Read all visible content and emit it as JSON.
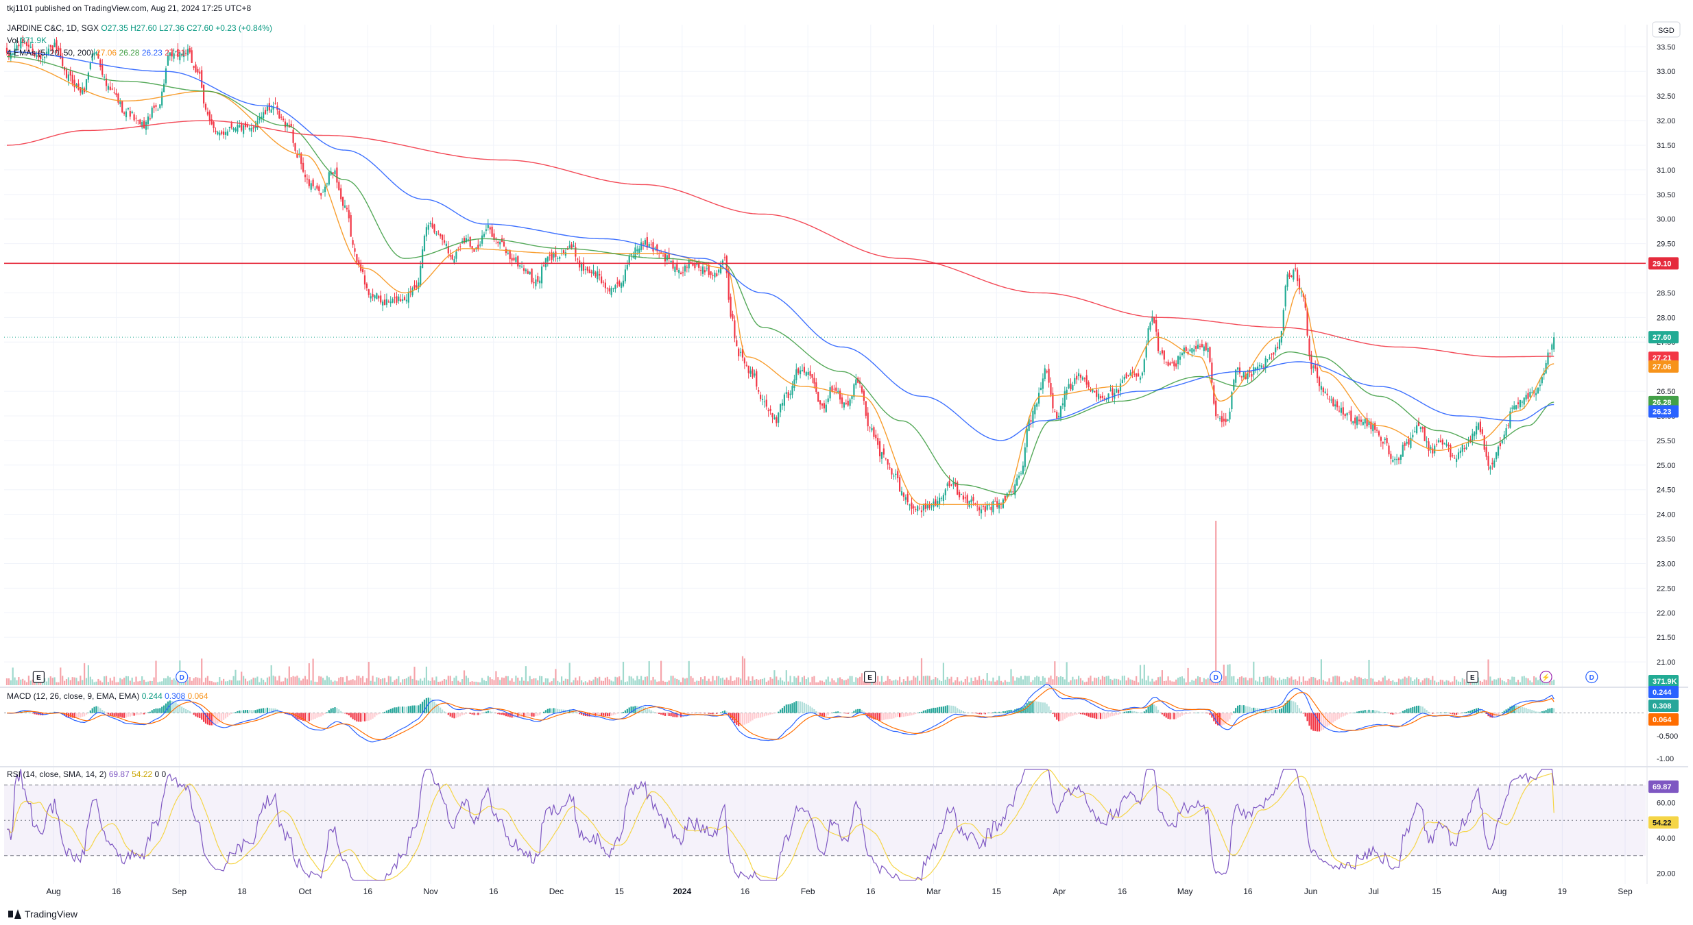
{
  "publisher_line": "tkj1101 published on TradingView.com, Aug 21, 2024 17:25 UTC+8",
  "symbol_legend": {
    "name": "JARDINE C&C, 1D, SGX",
    "open": "O27.35",
    "high": "H27.60",
    "low": "L27.36",
    "close": "C27.60",
    "change": "+0.23 (+0.84%)"
  },
  "volume_legend": {
    "label": "Vol",
    "value": "371.9K"
  },
  "ema_legend": {
    "label": "4 EMAs (5, 20, 50, 200)",
    "values": [
      "27.06",
      "26.28",
      "26.23",
      "27.21"
    ]
  },
  "macd_legend": {
    "label": "MACD (12, 26, close, 9, EMA, EMA)",
    "values": [
      "0.244",
      "0.308",
      "0.064"
    ]
  },
  "rsi_legend": {
    "label": "RSI (14, close, SMA, 14, 2)",
    "values": [
      "69.87",
      "54.22",
      "0",
      "0"
    ]
  },
  "footer": {
    "brand": "TradingView"
  },
  "colors": {
    "up": "#22ab94",
    "down": "#f23645",
    "ema5": "#f7931a",
    "ema20": "#43a047",
    "ema50": "#2962ff",
    "ema200": "#f23645",
    "macd": "#2962ff",
    "signal": "#ff6d00",
    "rsi": "#7e57c2",
    "rsi_ma": "#f5d547"
  },
  "chart_data": {
    "type": "candlestick",
    "currency": "SGD",
    "price_axis_ticks": [
      "33.50",
      "33.00",
      "32.50",
      "32.00",
      "31.50",
      "31.00",
      "30.50",
      "30.00",
      "29.50",
      "28.50",
      "28.00",
      "27.50",
      "26.50",
      "26.00",
      "25.50",
      "25.00",
      "24.50",
      "24.00",
      "23.50",
      "23.00",
      "22.50",
      "22.00",
      "21.50",
      "21.00"
    ],
    "price_range": [
      20.5,
      33.95
    ],
    "time_axis_labels": [
      "Aug",
      "16",
      "Sep",
      "18",
      "Oct",
      "16",
      "Nov",
      "16",
      "Dec",
      "15",
      "2024",
      "16",
      "Feb",
      "16",
      "Mar",
      "15",
      "Apr",
      "16",
      "May",
      "16",
      "Jun",
      "Jul",
      "15",
      "Aug",
      "19",
      "Sep"
    ],
    "horizontal_level": {
      "value": 29.1,
      "label": "29.10"
    },
    "last_price": {
      "value": 27.6,
      "label": "27.60"
    },
    "price_badges": [
      {
        "label": "27.21",
        "value": 27.21,
        "series": "EMA 200"
      },
      {
        "label": "27.06",
        "value": 27.06,
        "series": "EMA 5"
      },
      {
        "label": "26.28",
        "value": 26.28,
        "series": "EMA 20"
      },
      {
        "label": "26.23",
        "value": 26.23,
        "series": "EMA 50"
      }
    ],
    "volume_badge": "371.9K",
    "events": [
      {
        "type": "E",
        "label": "E",
        "date_index": 16
      },
      {
        "type": "D",
        "label": "D",
        "date_index": 88
      },
      {
        "type": "E",
        "label": "E",
        "date_index": 434
      },
      {
        "type": "D",
        "label": "D",
        "date_index": 608
      },
      {
        "type": "E",
        "label": "E",
        "date_index": 737
      },
      {
        "type": "flash",
        "label": "⚡",
        "date_index": 774
      },
      {
        "type": "D",
        "label": "D",
        "date_index": 797
      }
    ],
    "anchor_closes": [
      [
        0,
        33.3
      ],
      [
        8,
        33.6
      ],
      [
        16,
        33.3
      ],
      [
        24,
        33.5
      ],
      [
        30,
        32.9
      ],
      [
        38,
        32.6
      ],
      [
        44,
        33.4
      ],
      [
        52,
        32.6
      ],
      [
        60,
        32.2
      ],
      [
        68,
        31.9
      ],
      [
        76,
        32.3
      ],
      [
        82,
        33.3
      ],
      [
        90,
        33.4
      ],
      [
        96,
        33.0
      ],
      [
        100,
        32.2
      ],
      [
        106,
        31.7
      ],
      [
        114,
        31.9
      ],
      [
        122,
        31.8
      ],
      [
        128,
        32.1
      ],
      [
        134,
        32.3
      ],
      [
        138,
        32.0
      ],
      [
        142,
        31.9
      ],
      [
        146,
        31.3
      ],
      [
        152,
        30.7
      ],
      [
        158,
        30.5
      ],
      [
        164,
        31.0
      ],
      [
        170,
        30.2
      ],
      [
        176,
        29.2
      ],
      [
        182,
        28.5
      ],
      [
        190,
        28.3
      ],
      [
        200,
        28.4
      ],
      [
        206,
        28.7
      ],
      [
        212,
        29.9
      ],
      [
        218,
        29.7
      ],
      [
        224,
        29.2
      ],
      [
        230,
        29.6
      ],
      [
        236,
        29.4
      ],
      [
        242,
        29.8
      ],
      [
        248,
        29.5
      ],
      [
        254,
        29.2
      ],
      [
        260,
        29.0
      ],
      [
        266,
        28.7
      ],
      [
        272,
        29.2
      ],
      [
        278,
        29.3
      ],
      [
        284,
        29.4
      ],
      [
        290,
        29.0
      ],
      [
        296,
        28.9
      ],
      [
        302,
        28.6
      ],
      [
        308,
        28.6
      ],
      [
        314,
        29.3
      ],
      [
        320,
        29.5
      ],
      [
        326,
        29.4
      ],
      [
        332,
        29.2
      ],
      [
        338,
        28.9
      ],
      [
        344,
        29.1
      ],
      [
        350,
        29.0
      ],
      [
        356,
        28.9
      ],
      [
        361,
        29.2
      ],
      [
        364,
        28.0
      ],
      [
        368,
        27.3
      ],
      [
        374,
        26.9
      ],
      [
        380,
        26.4
      ],
      [
        386,
        25.9
      ],
      [
        392,
        26.4
      ],
      [
        398,
        26.9
      ],
      [
        404,
        26.9
      ],
      [
        410,
        26.2
      ],
      [
        416,
        26.6
      ],
      [
        422,
        26.2
      ],
      [
        428,
        26.7
      ],
      [
        434,
        25.8
      ],
      [
        440,
        25.2
      ],
      [
        446,
        24.8
      ],
      [
        452,
        24.3
      ],
      [
        458,
        24.1
      ],
      [
        466,
        24.2
      ],
      [
        474,
        24.6
      ],
      [
        482,
        24.3
      ],
      [
        490,
        24.1
      ],
      [
        498,
        24.2
      ],
      [
        504,
        24.4
      ],
      [
        510,
        24.8
      ],
      [
        514,
        25.9
      ],
      [
        518,
        26.3
      ],
      [
        522,
        26.9
      ],
      [
        528,
        26.0
      ],
      [
        534,
        26.6
      ],
      [
        540,
        26.8
      ],
      [
        546,
        26.5
      ],
      [
        552,
        26.4
      ],
      [
        558,
        26.5
      ],
      [
        564,
        26.8
      ],
      [
        570,
        26.8
      ],
      [
        576,
        28.0
      ],
      [
        580,
        27.3
      ],
      [
        586,
        27.0
      ],
      [
        592,
        27.3
      ],
      [
        598,
        27.4
      ],
      [
        604,
        27.3
      ],
      [
        608,
        26.0
      ],
      [
        612,
        25.8
      ],
      [
        614,
        25.9
      ],
      [
        618,
        26.9
      ],
      [
        624,
        26.8
      ],
      [
        630,
        27.0
      ],
      [
        636,
        27.2
      ],
      [
        640,
        27.5
      ],
      [
        644,
        28.8
      ],
      [
        648,
        28.9
      ],
      [
        652,
        28.4
      ],
      [
        656,
        27.0
      ],
      [
        662,
        26.5
      ],
      [
        668,
        26.2
      ],
      [
        674,
        26.0
      ],
      [
        680,
        25.9
      ],
      [
        686,
        25.8
      ],
      [
        692,
        25.5
      ],
      [
        698,
        25.1
      ],
      [
        704,
        25.4
      ],
      [
        710,
        25.8
      ],
      [
        716,
        25.3
      ],
      [
        722,
        25.5
      ],
      [
        728,
        25.1
      ],
      [
        734,
        25.4
      ],
      [
        740,
        25.8
      ],
      [
        746,
        25.0
      ],
      [
        752,
        25.5
      ],
      [
        758,
        26.2
      ],
      [
        764,
        26.4
      ],
      [
        770,
        26.5
      ],
      [
        776,
        27.35
      ],
      [
        778,
        27.6
      ]
    ],
    "series": [
      {
        "name": "EMA 5",
        "anchors": [
          [
            0,
            33.2
          ],
          [
            60,
            32.4
          ],
          [
            100,
            32.6
          ],
          [
            150,
            31.3
          ],
          [
            180,
            29.0
          ],
          [
            200,
            28.5
          ],
          [
            230,
            29.4
          ],
          [
            280,
            29.3
          ],
          [
            330,
            29.3
          ],
          [
            362,
            29.0
          ],
          [
            372,
            27.2
          ],
          [
            400,
            26.6
          ],
          [
            430,
            26.4
          ],
          [
            460,
            24.2
          ],
          [
            500,
            24.2
          ],
          [
            520,
            26.4
          ],
          [
            560,
            26.6
          ],
          [
            578,
            27.6
          ],
          [
            600,
            27.2
          ],
          [
            610,
            26.3
          ],
          [
            640,
            27.6
          ],
          [
            650,
            28.6
          ],
          [
            662,
            26.9
          ],
          [
            690,
            25.8
          ],
          [
            720,
            25.3
          ],
          [
            740,
            25.5
          ],
          [
            760,
            26.1
          ],
          [
            778,
            27.06
          ]
        ]
      },
      {
        "name": "EMA 20",
        "anchors": [
          [
            0,
            33.3
          ],
          [
            60,
            32.8
          ],
          [
            100,
            32.6
          ],
          [
            140,
            31.9
          ],
          [
            170,
            30.8
          ],
          [
            200,
            29.2
          ],
          [
            240,
            29.6
          ],
          [
            280,
            29.4
          ],
          [
            330,
            29.2
          ],
          [
            360,
            29.1
          ],
          [
            380,
            27.8
          ],
          [
            420,
            26.9
          ],
          [
            450,
            25.9
          ],
          [
            480,
            24.6
          ],
          [
            505,
            24.4
          ],
          [
            525,
            25.9
          ],
          [
            560,
            26.3
          ],
          [
            600,
            26.8
          ],
          [
            620,
            26.6
          ],
          [
            645,
            27.3
          ],
          [
            660,
            27.2
          ],
          [
            690,
            26.4
          ],
          [
            720,
            25.7
          ],
          [
            745,
            25.4
          ],
          [
            765,
            25.8
          ],
          [
            778,
            26.28
          ]
        ]
      },
      {
        "name": "EMA 50",
        "anchors": [
          [
            0,
            33.4
          ],
          [
            80,
            33.0
          ],
          [
            130,
            32.3
          ],
          [
            170,
            31.4
          ],
          [
            210,
            30.4
          ],
          [
            240,
            29.9
          ],
          [
            300,
            29.6
          ],
          [
            350,
            29.2
          ],
          [
            380,
            28.5
          ],
          [
            420,
            27.4
          ],
          [
            460,
            26.4
          ],
          [
            500,
            25.5
          ],
          [
            520,
            25.9
          ],
          [
            570,
            26.5
          ],
          [
            620,
            26.9
          ],
          [
            650,
            27.1
          ],
          [
            690,
            26.6
          ],
          [
            730,
            26.0
          ],
          [
            760,
            25.9
          ],
          [
            778,
            26.23
          ]
        ]
      },
      {
        "name": "EMA 200",
        "anchors": [
          [
            0,
            31.5
          ],
          [
            40,
            31.8
          ],
          [
            100,
            32.0
          ],
          [
            160,
            31.7
          ],
          [
            250,
            31.2
          ],
          [
            320,
            30.7
          ],
          [
            380,
            30.1
          ],
          [
            450,
            29.2
          ],
          [
            520,
            28.5
          ],
          [
            580,
            28.0
          ],
          [
            640,
            27.8
          ],
          [
            700,
            27.4
          ],
          [
            750,
            27.2
          ],
          [
            778,
            27.21
          ]
        ]
      }
    ],
    "macd_axis_ticks": [
      "-0.500",
      "-1.00"
    ],
    "macd_range": [
      -1.15,
      0.55
    ],
    "macd_last": {
      "macd": "0.244",
      "signal": "0.308",
      "histogram": "0.064"
    },
    "rsi_axis_ticks": [
      "60.00",
      "40.00",
      "20.00"
    ],
    "rsi_range": [
      14,
      80
    ],
    "rsi_last": {
      "rsi": "69.87",
      "ma": "54.22"
    }
  }
}
